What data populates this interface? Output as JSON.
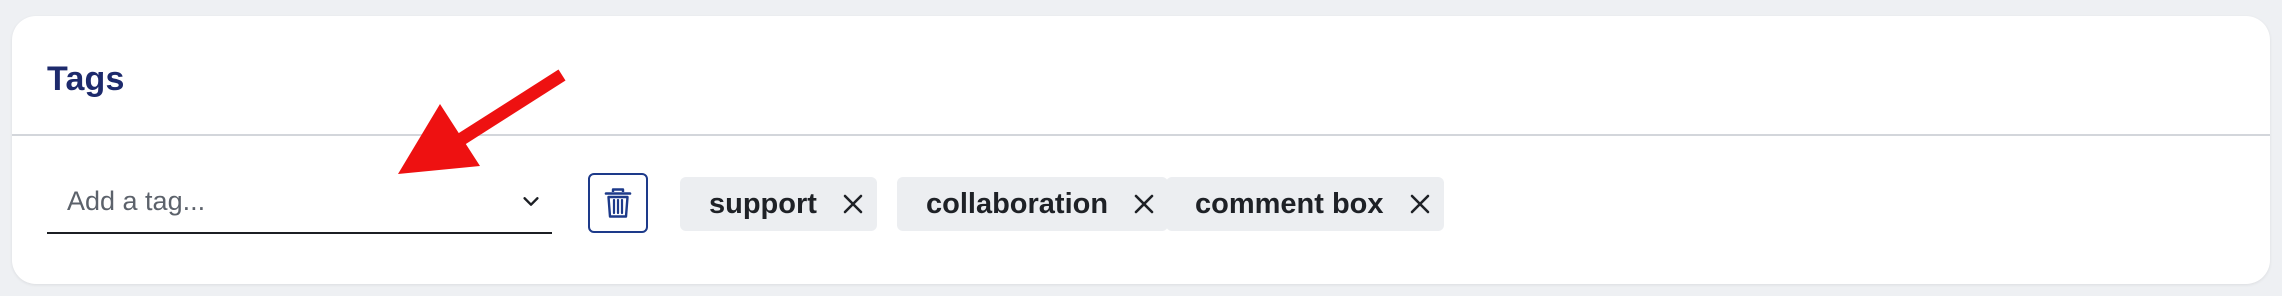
{
  "card": {
    "title": "Tags"
  },
  "tag_select": {
    "placeholder": "Add a tag..."
  },
  "tags": [
    {
      "label": "support"
    },
    {
      "label": "collaboration"
    },
    {
      "label": "comment box"
    }
  ],
  "icons": {
    "dropdown": "chevron-down-icon",
    "delete": "trash-icon",
    "remove_tag": "close-icon",
    "annotation": "red-arrow-icon"
  },
  "colors": {
    "title": "#1d2a6c",
    "accent": "#1d3a8a",
    "tag_background": "#eceef1",
    "annotation_arrow": "#ee1111"
  }
}
